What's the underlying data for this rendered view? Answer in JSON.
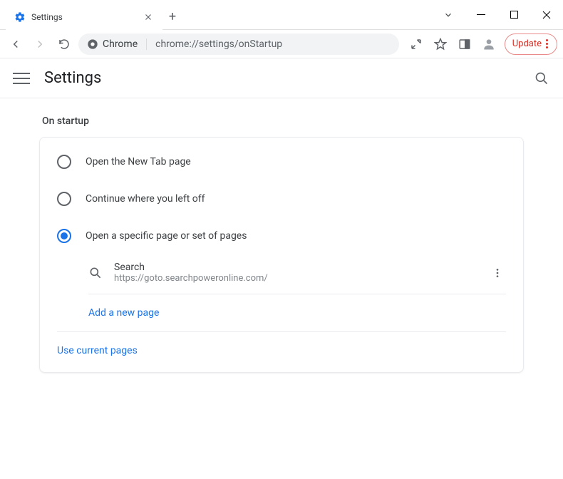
{
  "window": {
    "tab": {
      "title": "Settings"
    }
  },
  "omnibox": {
    "chip": "Chrome",
    "url": "chrome://settings/onStartup"
  },
  "toolbar": {
    "update_label": "Update"
  },
  "header": {
    "title": "Settings"
  },
  "section": {
    "label": "On startup"
  },
  "options": [
    {
      "label": "Open the New Tab page",
      "selected": false
    },
    {
      "label": "Continue where you left off",
      "selected": false
    },
    {
      "label": "Open a specific page or set of pages",
      "selected": true
    }
  ],
  "page_entry": {
    "title": "Search",
    "url": "https://goto.searchpoweronline.com/"
  },
  "links": {
    "add_page": "Add a new page",
    "use_current": "Use current pages"
  }
}
